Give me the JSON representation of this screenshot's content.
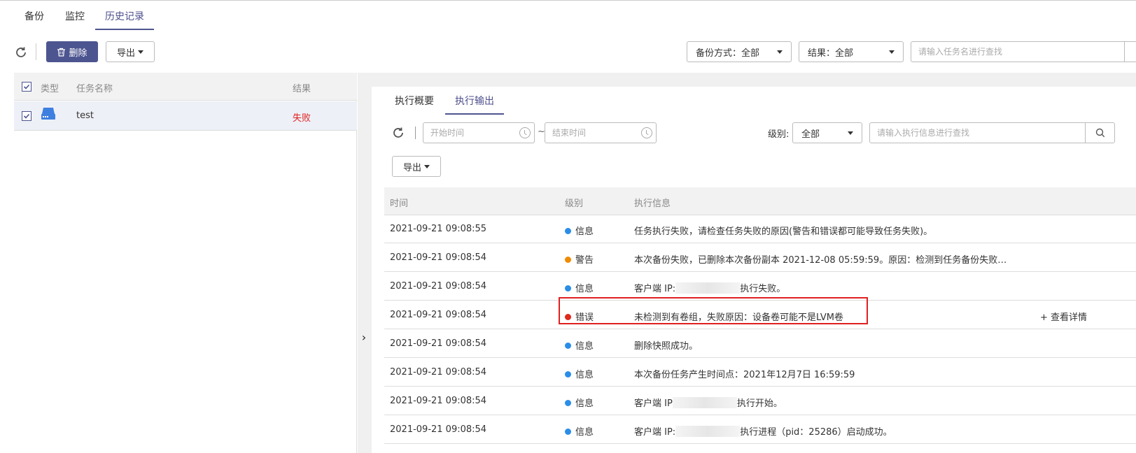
{
  "top_tabs": [
    {
      "label": "备份"
    },
    {
      "label": "监控"
    },
    {
      "label": "历史记录"
    }
  ],
  "toolbar": {
    "delete_label": "删除",
    "export_label": "导出",
    "backup_mode_filter": "备份方式：全部",
    "result_filter": "结果：全部",
    "search_placeholder": "请输入任务名进行查找"
  },
  "task_table": {
    "columns": {
      "type": "类型",
      "name": "任务名称",
      "result": "结果"
    },
    "rows": [
      {
        "name": "test",
        "result": "失败",
        "icon": "server-icon",
        "result_color": "#e02020"
      }
    ]
  },
  "detail": {
    "tabs": [
      {
        "label": "执行概要"
      },
      {
        "label": "执行输出"
      }
    ],
    "start_placeholder": "开始时间",
    "end_placeholder": "结束时间",
    "range_separator": "~",
    "level_label": "级别:",
    "level_value": "全部",
    "search_placeholder": "请输入执行信息进行查找",
    "export_label": "导出",
    "columns": {
      "time": "时间",
      "level": "级别",
      "message": "执行信息"
    },
    "rows": [
      {
        "time": "2021-09-21 09:08:55",
        "level": "信息",
        "color": "#2a8de8",
        "message": "任务执行失败，请检查任务失败的原因(警告和错误都可能导致任务失败)。"
      },
      {
        "time": "2021-09-21 09:08:54",
        "level": "警告",
        "color": "#f08a00",
        "message": "本次备份失败，已删除本次备份副本 2021-12-08 05:59:59。原因：检测到任务备份失败…"
      },
      {
        "time": "2021-09-21 09:08:54",
        "level": "信息",
        "color": "#2a8de8",
        "message_pre": "客户端 IP:",
        "message_post": "执行失败。"
      },
      {
        "time": "2021-09-21 09:08:54",
        "level": "错误",
        "color": "#e0281c",
        "message": "未检测到有卷组，失败原因：设备卷可能不是LVM卷",
        "link": "+ 查看详情"
      },
      {
        "time": "2021-09-21 09:08:54",
        "level": "信息",
        "color": "#2a8de8",
        "message": "删除快照成功。"
      },
      {
        "time": "2021-09-21 09:08:54",
        "level": "信息",
        "color": "#2a8de8",
        "message": "本次备份任务产生时间点：2021年12月7日 16:59:59"
      },
      {
        "time": "2021-09-21 09:08:54",
        "level": "信息",
        "color": "#2a8de8",
        "message_pre": "客户端 IP",
        "message_post": "执行开始。"
      },
      {
        "time": "2021-09-21 09:08:54",
        "level": "信息",
        "color": "#2a8de8",
        "message_pre": "客户端 IP:",
        "message_post": "执行进程（pid：25286）启动成功。"
      }
    ]
  }
}
